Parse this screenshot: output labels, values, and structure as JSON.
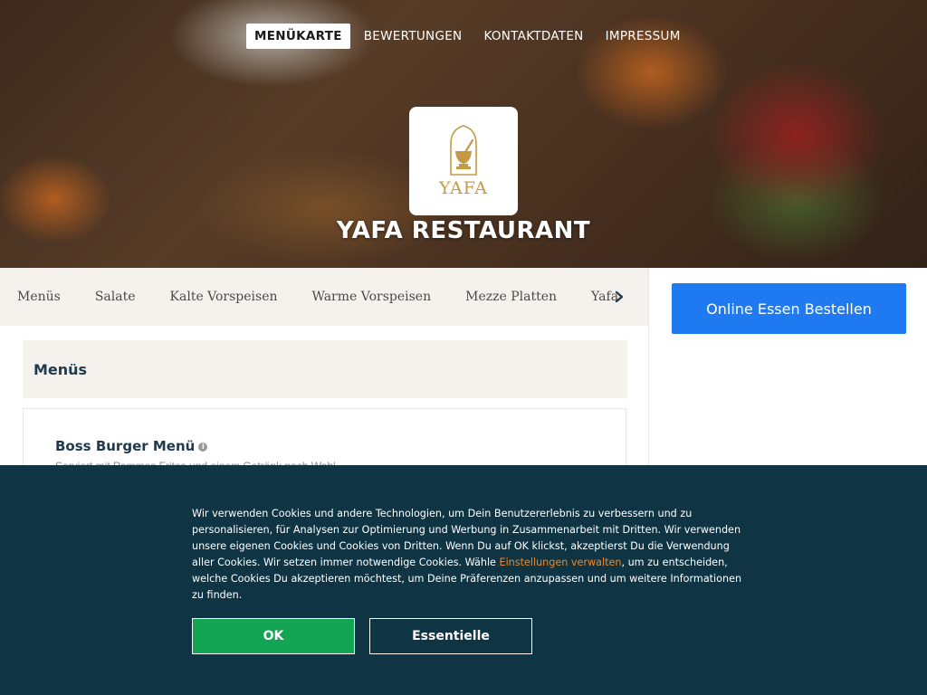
{
  "nav": {
    "items": [
      "MENÜKARTE",
      "BEWERTUNGEN",
      "KONTAKTDATEN",
      "IMPRESSUM"
    ],
    "active_index": 0
  },
  "logo": {
    "text": "YAFA"
  },
  "restaurant": {
    "name": "YAFA RESTAURANT"
  },
  "categories": [
    "Menüs",
    "Salate",
    "Kalte Vorspeisen",
    "Warme Vorspeisen",
    "Mezze Platten",
    "Yafa"
  ],
  "section": {
    "title": "Menüs"
  },
  "item": {
    "name": "Boss Burger Menü",
    "info_icon": "i",
    "description": "Serviert mit Pommes Frites und einem Getränk nach Wahl"
  },
  "sidebar": {
    "order_button": "Online Essen Bestellen"
  },
  "cookie": {
    "text_before": "Wir verwenden Cookies und andere Technologien, um Dein Benutzererlebnis zu verbessern und zu personalisieren, für Analysen zur Optimierung und Werbung in Zusammenarbeit mit Dritten. Wir verwenden unsere eigenen Cookies und Cookies von Dritten. Wenn Du auf OK klickst, akzeptierst Du die Verwendung aller Cookies. Wir setzen immer notwendige Cookies. Wähle ",
    "link": "Einstellungen verwalten",
    "text_after": ", um zu entscheiden, welche Cookies Du akzeptieren möchtest, um Deine Präferenzen anzupassen und um weitere Informationen zu finden.",
    "ok_label": "OK",
    "essential_label": "Essentielle"
  },
  "colors": {
    "order_button": "#1f79f0",
    "cookie_background": "#0f3443",
    "ok_button": "#13a553",
    "link": "#f5871f",
    "heading": "#1f3a4d"
  }
}
